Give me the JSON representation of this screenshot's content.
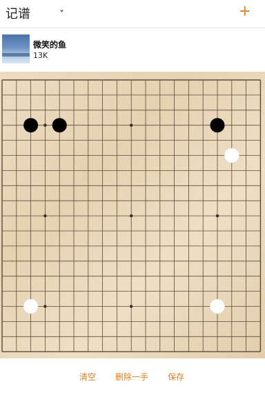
{
  "header": {
    "title": "记谱",
    "add_label": "+"
  },
  "player": {
    "name": "微笑的鱼",
    "rank": "13K"
  },
  "board": {
    "size": 19,
    "star_points": [
      [
        3,
        3
      ],
      [
        3,
        9
      ],
      [
        3,
        15
      ],
      [
        9,
        3
      ],
      [
        9,
        9
      ],
      [
        9,
        15
      ],
      [
        15,
        3
      ],
      [
        15,
        9
      ],
      [
        15,
        15
      ]
    ],
    "stones": [
      {
        "color": "black",
        "col": 2,
        "row": 3
      },
      {
        "color": "black",
        "col": 4,
        "row": 3
      },
      {
        "color": "black",
        "col": 15,
        "row": 3
      },
      {
        "color": "white",
        "col": 16,
        "row": 5
      },
      {
        "color": "white",
        "col": 2,
        "row": 15
      },
      {
        "color": "white",
        "col": 15,
        "row": 15
      }
    ]
  },
  "footer": {
    "clear": "清空",
    "undo": "删除一手",
    "save": "保存"
  },
  "colors": {
    "accent": "#e0822b",
    "line": "#5a4a3a"
  }
}
